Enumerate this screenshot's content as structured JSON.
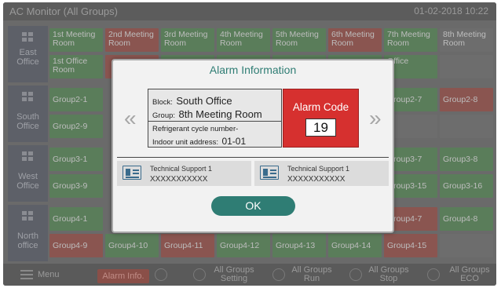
{
  "header": {
    "title": "AC Monitor (All Groups)",
    "clock": "01-02-2018 10:22"
  },
  "rows": [
    {
      "label": [
        "East",
        "Office"
      ],
      "cells": [
        [
          [
            "1st Meeting",
            "Room"
          ],
          [
            "2nd Meeting",
            "Room"
          ],
          [
            "3rd Meeting",
            "Room"
          ],
          [
            "4th Meeting",
            "Room"
          ],
          [
            "5th Meeting",
            "Room"
          ],
          [
            "6th Meeting",
            "Room"
          ],
          [
            "7th Meeting",
            "Room"
          ],
          [
            "8th Meeting",
            "Room"
          ]
        ],
        [
          [
            "1st Office",
            "Room"
          ],
          [
            "",
            ""
          ],
          [
            "",
            ""
          ],
          [
            "",
            ""
          ],
          [
            "",
            ""
          ],
          [
            "",
            ""
          ],
          [
            "",
            "Office"
          ],
          [
            "",
            ""
          ]
        ]
      ]
    },
    {
      "label": [
        "South",
        "Office"
      ],
      "cells": [
        [
          "Group2-1",
          "",
          "",
          "",
          "",
          "",
          "Group2-7",
          "Group2-8"
        ],
        [
          "Group2-9",
          "",
          "",
          "",
          "",
          "",
          "",
          ""
        ]
      ]
    },
    {
      "label": [
        "West",
        "Office"
      ],
      "cells": [
        [
          "Group3-1",
          "",
          "",
          "",
          "",
          "",
          "Group3-7",
          "Group3-8"
        ],
        [
          "Group3-9",
          "",
          "",
          "",
          "",
          "",
          "Group3-15",
          "Group3-16"
        ]
      ]
    },
    {
      "label": [
        "North",
        "office"
      ],
      "cells": [
        [
          "Group4-1",
          "",
          "",
          "",
          "",
          "",
          "Group4-7",
          "Group4-8"
        ],
        [
          "Group4-9",
          "Group4-10",
          "Group4-11",
          "Group4-12",
          "Group4-13",
          "Group4-14",
          "Group4-15",
          ""
        ]
      ]
    }
  ],
  "bottom_bar": {
    "menu": "Menu",
    "alarm": "Alarm Info.",
    "setting": [
      "All Groups",
      "Setting"
    ],
    "run": [
      "All Groups",
      "Run"
    ],
    "stop": [
      "All Groups",
      "Stop"
    ],
    "eco": [
      "All Groups",
      "ECO"
    ]
  },
  "modal": {
    "title": "Alarm Information",
    "block_label": "Block:",
    "block_value": "South Office",
    "group_label": "Group:",
    "group_value": "8th Meeting Room",
    "refrigerant_label": "Refrigerant cycle number-",
    "indoor_label": "Indoor unit address:",
    "indoor_value": "01-01",
    "alarm_code_label": "Alarm Code",
    "alarm_code_value": "19",
    "support": [
      {
        "name": "Technical Support 1",
        "number": "XXXXXXXXXXX"
      },
      {
        "name": "Technical Support 1",
        "number": "XXXXXXXXXXX"
      }
    ],
    "ok_label": "OK",
    "prev_arrow": "«",
    "next_arrow": "»"
  },
  "colors": {
    "accent": "#2f7d74",
    "alarm_red": "#d6302f",
    "cell_green": "#5a7d5a",
    "cell_red": "#8a5550"
  }
}
